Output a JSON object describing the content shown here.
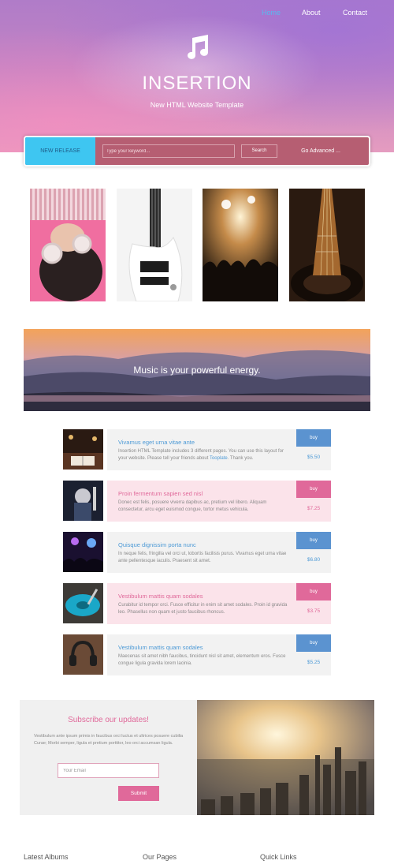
{
  "nav": {
    "items": [
      "Home",
      "About",
      "Contact"
    ],
    "active": "Home"
  },
  "header": {
    "icon": "music-note-icon",
    "title": "INSERTION",
    "subtitle": "New HTML Website Template"
  },
  "search": {
    "tab_label": "NEW RELEASE",
    "placeholder": "Type your keyword...",
    "button_label": "Search",
    "advanced_label": "Go Advanced ..."
  },
  "gallery": [
    {
      "alt": "girl with headphones"
    },
    {
      "alt": "white bass guitar"
    },
    {
      "alt": "concert crowd"
    },
    {
      "alt": "guitar neck"
    }
  ],
  "banner": {
    "text": "Music is your powerful energy."
  },
  "tracks": [
    {
      "title": "Vivamus eget urna vitae ante",
      "desc": "Insertion HTML Template includes 3 different pages. You can use this layout for your website. Please tell your friends about",
      "link": "Tooplate",
      "desc_after": ". Thank you.",
      "buy": "buy",
      "price": "$5.50"
    },
    {
      "title": "Proin fermentum sapien sed nisl",
      "desc": "Donec est felis, posuere viverra dapibus ac, pretium vel libero. Aliquam consectetur, arcu eget euismod congue, tortor metus vehicula.",
      "link": "",
      "desc_after": "",
      "buy": "buy",
      "price": "$7.25"
    },
    {
      "title": "Quisque dignissim porta nunc",
      "desc": "In neque felis, fringilla vel orci ut, lobortis facilisis purus. Vivamus eget urna vitae ante pellentesque iaculis. Praesent sit amet.",
      "link": "",
      "desc_after": "",
      "buy": "buy",
      "price": "$6.80"
    },
    {
      "title": "Vestibulum mattis quam sodales",
      "desc": "Curabitur id tempor orci. Fusce efficitur in enim sit amet sodales. Proin id gravida leo. Phasellus non quam et justo faucibus rhoncus.",
      "link": "",
      "desc_after": "",
      "buy": "buy",
      "price": "$3.75"
    },
    {
      "title": "Vestibulum mattis quam sodales",
      "desc": "Maecenas sit amet nibh faucibus, tincidunt nisl sit amet, elementum eros. Fusce congue ligula gravida lorem lacinia.",
      "link": "",
      "desc_after": "",
      "buy": "buy",
      "price": "$5.25"
    }
  ],
  "subscribe": {
    "title": "Subscribe our updates!",
    "text": "Vestibulum ante ipsum primis in faucibus orci luctus et ultrices posuere cubilia Curae; Morbi semper, ligula et pretium porttitor, leo orci accumsan ligula.",
    "email_placeholder": "Your Email",
    "submit_label": "Submit"
  },
  "footer": {
    "col1": "Latest Albums",
    "col2": "Our Pages",
    "col3": "Quick Links"
  },
  "colors": {
    "accent_pink": "#e0699a",
    "accent_blue": "#4d9ad6",
    "release_blue": "#3ec6f1",
    "search_bg": "#b65e72"
  }
}
